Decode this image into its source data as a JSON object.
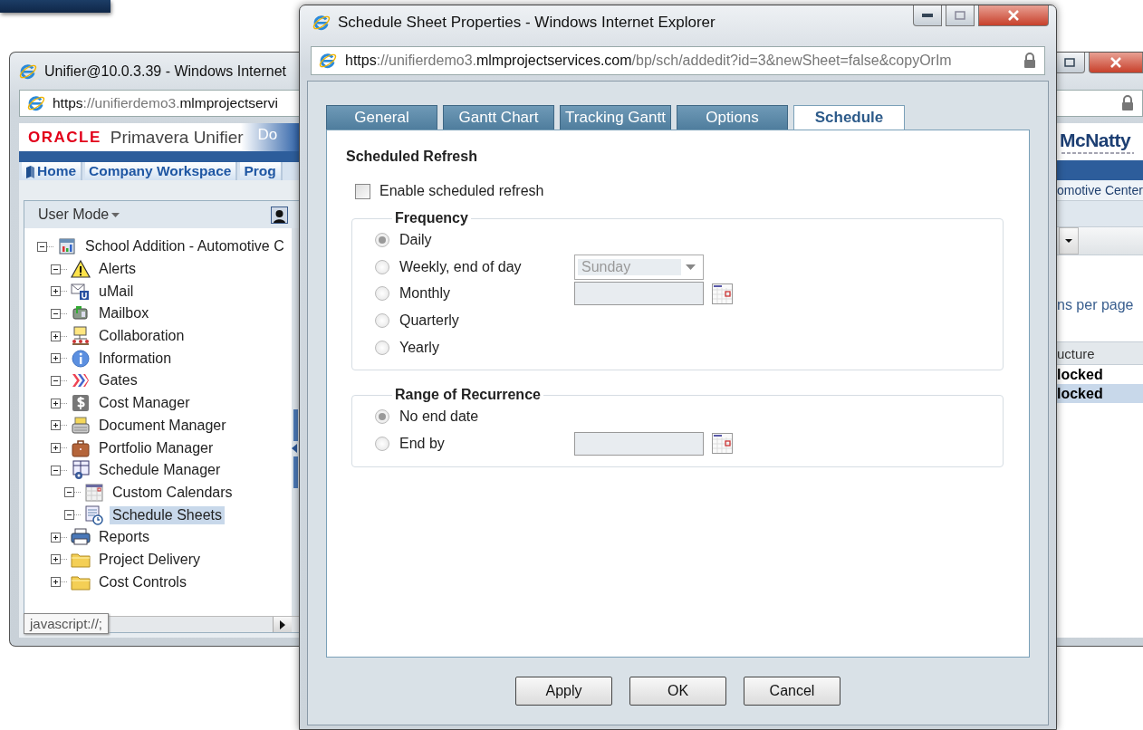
{
  "background_window": {
    "title": "Unifier@10.0.3.39 - Windows Internet",
    "address": [
      {
        "text": "https",
        "strong": true
      },
      {
        "text": "://unifierdemo3.",
        "strong": false
      },
      {
        "text": "mlmprojectservi",
        "strong": true
      }
    ],
    "header": {
      "logo": "ORACLE",
      "product": "Primavera Unifier",
      "link": "Do"
    },
    "tabs": [
      {
        "label": "Home",
        "kind": "icon",
        "selected": false
      },
      {
        "label": "Company Workspace",
        "kind": "text",
        "selected": false
      },
      {
        "label": "Prog",
        "kind": "text",
        "selected": false
      }
    ],
    "mode_menu": "User Mode",
    "tree": [
      {
        "label": "School Addition - Automotive C",
        "kind": "project",
        "expanded": true,
        "selected": false,
        "children": [
          {
            "label": "Alerts",
            "kind": "warning",
            "expanded": true,
            "selected": false
          },
          {
            "label": "uMail",
            "kind": "mail",
            "expanded": false,
            "selected": false
          },
          {
            "label": "Mailbox",
            "kind": "mailbox",
            "expanded": true,
            "selected": false
          },
          {
            "label": "Collaboration",
            "kind": "collaboration",
            "expanded": false,
            "selected": false
          },
          {
            "label": "Information",
            "kind": "info",
            "expanded": false,
            "selected": false
          },
          {
            "label": "Gates",
            "kind": "gates",
            "expanded": true,
            "selected": false
          },
          {
            "label": "Cost Manager",
            "kind": "dollar",
            "expanded": false,
            "selected": false
          },
          {
            "label": "Document Manager",
            "kind": "document",
            "expanded": false,
            "selected": false
          },
          {
            "label": "Portfolio Manager",
            "kind": "briefcase",
            "expanded": false,
            "selected": false
          },
          {
            "label": "Schedule Manager",
            "kind": "schedule",
            "expanded": true,
            "selected": false,
            "children": [
              {
                "label": "Custom Calendars",
                "kind": "calendar",
                "expanded": true,
                "selected": false
              },
              {
                "label": "Schedule Sheets",
                "kind": "sheet",
                "expanded": true,
                "selected": true
              }
            ]
          },
          {
            "label": "Reports",
            "kind": "printer",
            "expanded": false,
            "selected": false
          },
          {
            "label": "Project Delivery",
            "kind": "folder",
            "expanded": false,
            "selected": false
          },
          {
            "label": "Cost Controls",
            "kind": "folder",
            "expanded": false,
            "selected": false
          }
        ]
      }
    ],
    "tooltip": "javascript://;",
    "right_pane": {
      "logo": "McNatty",
      "breadcrumb": "omotive Center",
      "paging": "ns per page",
      "column": "ucture",
      "rows": [
        {
          "text": "locked",
          "selected": false
        },
        {
          "text": "locked",
          "selected": true
        }
      ]
    }
  },
  "dialog": {
    "title": "Schedule Sheet Properties - Windows Internet Explorer",
    "address": [
      {
        "text": "https",
        "strong": true
      },
      {
        "text": "://unifierdemo3.",
        "strong": false
      },
      {
        "text": "mlmprojectservices.com",
        "strong": true
      },
      {
        "text": "/bp/sch/addedit?id=3&newSheet=false&copyOrIm",
        "strong": false
      }
    ],
    "tabs": [
      {
        "label": "General",
        "selected": false
      },
      {
        "label": "Gantt Chart",
        "selected": false
      },
      {
        "label": "Tracking Gantt",
        "selected": false
      },
      {
        "label": "Options",
        "selected": false
      },
      {
        "label": "Schedule",
        "selected": true
      }
    ],
    "section_title": "Scheduled Refresh",
    "enable_refresh": {
      "label": "Enable scheduled refresh",
      "checked": false
    },
    "groups": [
      {
        "legend": "Frequency",
        "disabled": true,
        "options": [
          {
            "label": "Daily",
            "kind": "plain",
            "selected": true
          },
          {
            "label": "Weekly, end of day",
            "kind": "select",
            "selected": false,
            "value": "Sunday"
          },
          {
            "label": "Monthly",
            "kind": "date",
            "selected": false
          },
          {
            "label": "Quarterly",
            "kind": "plain",
            "selected": false
          },
          {
            "label": "Yearly",
            "kind": "plain",
            "selected": false
          }
        ]
      },
      {
        "legend": "Range of Recurrence",
        "disabled": true,
        "options": [
          {
            "label": "No end date",
            "kind": "plain",
            "selected": true
          },
          {
            "label": "End by",
            "kind": "date",
            "selected": false
          }
        ]
      }
    ],
    "buttons": [
      "Apply",
      "OK",
      "Cancel"
    ]
  }
}
